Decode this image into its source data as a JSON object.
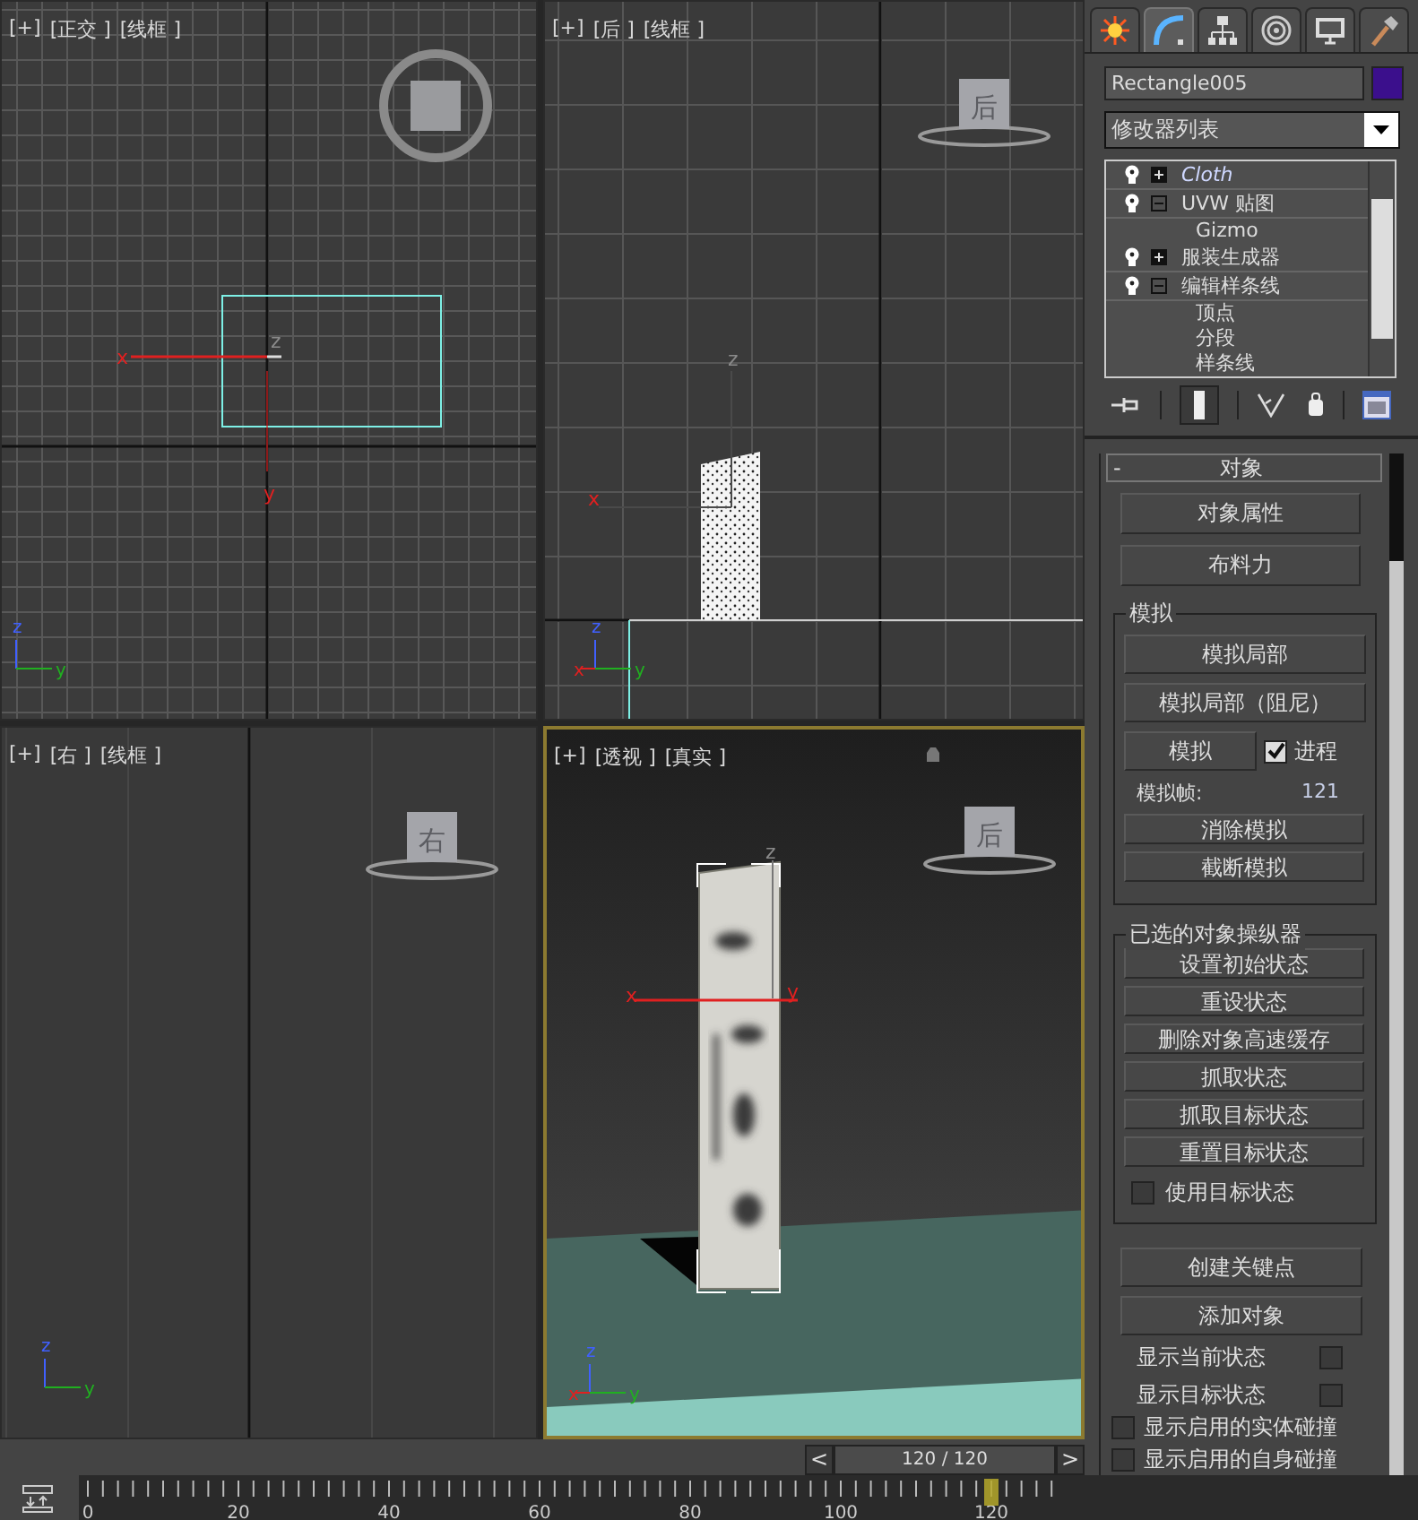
{
  "viewports": [
    {
      "kind": "top",
      "active": false,
      "labels": [
        "[+]",
        "[正交 ]",
        "[线框 ]"
      ],
      "gizmo": [
        {
          "kind": "x",
          "text": "x"
        },
        {
          "kind": "z",
          "text": "z"
        },
        {
          "kind": "y",
          "text": "y"
        }
      ],
      "tripod": [
        {
          "kind": "z",
          "text": "z"
        },
        {
          "kind": "y",
          "text": "y"
        }
      ]
    },
    {
      "kind": "back",
      "active": false,
      "labels": [
        "[+]",
        "[后 ]",
        "[线框 ]"
      ],
      "cube_label": "后",
      "gizmo": [
        {
          "kind": "z",
          "text": "z"
        },
        {
          "kind": "x",
          "text": "x"
        }
      ],
      "tripod": [
        {
          "kind": "z",
          "text": "z"
        },
        {
          "kind": "x",
          "text": "x"
        },
        {
          "kind": "y",
          "text": "y"
        }
      ]
    },
    {
      "kind": "right",
      "active": false,
      "labels": [
        "[+]",
        "[右 ]",
        "[线框 ]"
      ],
      "cube_label": "右",
      "tripod": [
        {
          "kind": "z",
          "text": "z"
        },
        {
          "kind": "y",
          "text": "y"
        }
      ]
    },
    {
      "kind": "perspective",
      "active": true,
      "labels": [
        "[+]",
        "[透视 ]",
        "[真实 ]"
      ],
      "cube_label": "后",
      "gizmo": [
        {
          "kind": "z",
          "text": "z"
        },
        {
          "kind": "x",
          "text": "x"
        },
        {
          "kind": "y",
          "text": "y"
        }
      ],
      "tripod": [
        {
          "kind": "z",
          "text": "z"
        },
        {
          "kind": "x",
          "text": "x"
        },
        {
          "kind": "y",
          "text": "y"
        }
      ]
    }
  ],
  "frame_slider": {
    "prev": "<",
    "position": "120 / 120",
    "next": ">"
  },
  "timeline": {
    "labels": [
      "0",
      "20",
      "40",
      "60",
      "80",
      "100",
      "120"
    ]
  },
  "command_panel": {
    "tabs": [
      {
        "kind": "create",
        "selected": false
      },
      {
        "kind": "modify",
        "selected": true
      },
      {
        "kind": "hierarchy",
        "selected": false
      },
      {
        "kind": "motion",
        "selected": false
      },
      {
        "kind": "display",
        "selected": false
      },
      {
        "kind": "utilities",
        "selected": false
      }
    ],
    "object": {
      "name": "Rectangle005",
      "color": "#3b0f8c"
    },
    "modifier_list": "修改器列表",
    "stack": [
      {
        "label": "Cloth",
        "italic": true,
        "expanded": false
      },
      {
        "label": "UVW 贴图",
        "italic": false,
        "expanded": true,
        "children": [
          {
            "label": "Gizmo"
          }
        ]
      },
      {
        "label": "服装生成器",
        "italic": false,
        "expanded": false
      },
      {
        "label": "编辑样条线",
        "italic": false,
        "expanded": true,
        "children": [
          {
            "label": "顶点"
          },
          {
            "label": "分段"
          },
          {
            "label": "样条线"
          }
        ]
      }
    ],
    "rollout": {
      "collapse": "-",
      "title": "对象",
      "buttons": [
        "对象属性",
        "布料力"
      ],
      "simulation": {
        "title": "模拟",
        "buttons": [
          "模拟局部",
          "模拟局部（阻尼）"
        ],
        "simulate": "模拟",
        "progress": {
          "label": "进程",
          "checked": true
        },
        "frame_label": "模拟帧:",
        "frame_value": "121",
        "small_buttons": [
          "消除模拟",
          "截断模拟"
        ]
      },
      "manipulators": {
        "title": "已选的对象操纵器",
        "buttons": [
          "设置初始状态",
          "重设状态",
          "删除对象高速缓存",
          "抓取状态",
          "抓取目标状态",
          "重置目标状态"
        ],
        "use_target": {
          "label": "使用目标状态",
          "checked": false
        }
      },
      "key_buttons": [
        "创建关键点",
        "添加对象"
      ],
      "display_options": [
        {
          "label": "显示当前状态",
          "checked": false,
          "kind": "trailing"
        },
        {
          "label": "显示目标状态",
          "checked": false,
          "kind": "trailing"
        },
        {
          "label": "显示启用的实体碰撞",
          "checked": false,
          "kind": "leading"
        },
        {
          "label": "显示启用的自身碰撞",
          "checked": false,
          "kind": "leading"
        }
      ]
    }
  }
}
